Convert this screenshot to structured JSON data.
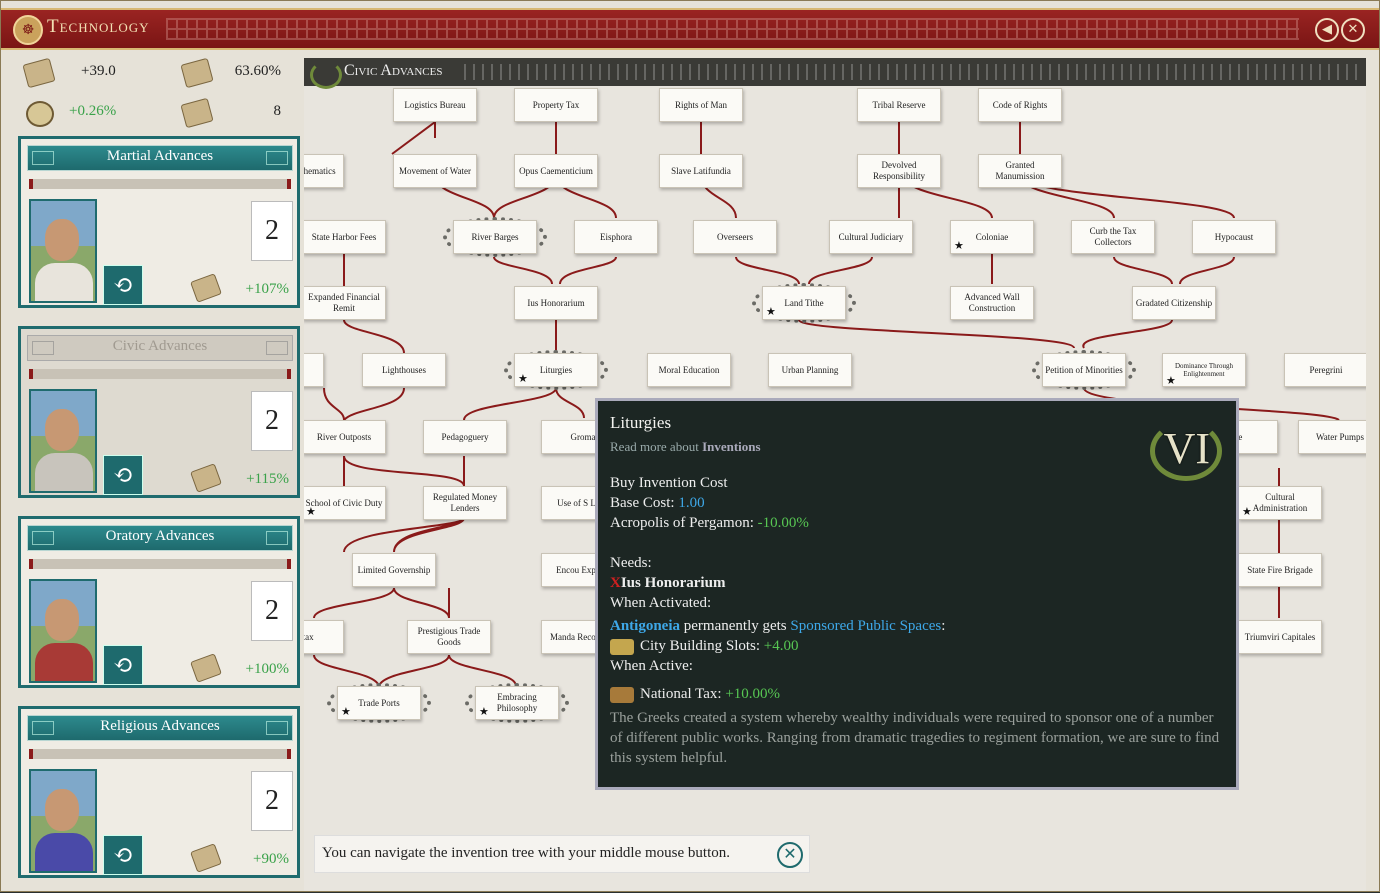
{
  "window": {
    "title": "Technology",
    "back_icon": "back-arrow-icon",
    "close_icon": "close-icon"
  },
  "stats": {
    "research_per_month": "+39.0",
    "research_efficiency": "63.60%",
    "progress_rate": "+0.26%",
    "innovation_count": "8"
  },
  "advances": [
    {
      "label": "Martial Advances",
      "level": "2",
      "bonus": "+107%",
      "icon": "helmet-icon",
      "active": true
    },
    {
      "label": "Civic Advances",
      "level": "2",
      "bonus": "+115%",
      "icon": "laurel-icon",
      "active": false
    },
    {
      "label": "Oratory Advances",
      "level": "2",
      "bonus": "+100%",
      "icon": "scroll-quill-icon",
      "active": true
    },
    {
      "label": "Religious Advances",
      "level": "2",
      "bonus": "+90%",
      "icon": "sun-icon",
      "active": true
    }
  ],
  "tree": {
    "header": "Civic Advances",
    "nodes": [
      {
        "label": "Logistics Bureau"
      },
      {
        "label": "Property Tax"
      },
      {
        "label": "Rights of Man"
      },
      {
        "label": "Tribal Reserve"
      },
      {
        "label": "Code of Rights"
      },
      {
        "label": "hagorean hematics"
      },
      {
        "label": "Movement of Water"
      },
      {
        "label": "Opus Caementicium"
      },
      {
        "label": "Slave Latifundia"
      },
      {
        "label": "Devolved Responsibility"
      },
      {
        "label": "Granted Manumission"
      },
      {
        "label": "State Harbor Fees"
      },
      {
        "label": "River Barges"
      },
      {
        "label": "Eisphora"
      },
      {
        "label": "Overseers"
      },
      {
        "label": "Cultural Judiciary"
      },
      {
        "label": "Coloniae"
      },
      {
        "label": "Curb the Tax Collectors"
      },
      {
        "label": "Hypocaust"
      },
      {
        "label": "Expanded Financial Remit"
      },
      {
        "label": "Ius Honorarium"
      },
      {
        "label": "Land Tithe"
      },
      {
        "label": "Advanced Wall Construction"
      },
      {
        "label": "Gradated Citizenship"
      },
      {
        "label": "Lighthouses"
      },
      {
        "label": "Liturgies"
      },
      {
        "label": "Moral Education"
      },
      {
        "label": "Urban Planning"
      },
      {
        "label": "Petition of Minorities"
      },
      {
        "label": "Dominance Through Enlightenment"
      },
      {
        "label": "Peregrini"
      },
      {
        "label": "River Outposts"
      },
      {
        "label": "Pedagoguery"
      },
      {
        "label": "Groma"
      },
      {
        "label": "al e"
      },
      {
        "label": "Water Pumps"
      },
      {
        "label": "School of Civic Duty"
      },
      {
        "label": "Regulated Money Lenders"
      },
      {
        "label": "Use of S Land"
      },
      {
        "label": "Cultural Administration"
      },
      {
        "label": "Limited Governship"
      },
      {
        "label": "Encou Explora"
      },
      {
        "label": "State Fire Brigade"
      },
      {
        "label": "ort tax"
      },
      {
        "label": "Prestigious Trade Goods"
      },
      {
        "label": "Manda Record Ke"
      },
      {
        "label": "Triumviri Capitales"
      },
      {
        "label": "Trade Ports"
      },
      {
        "label": "Embracing Philosophy"
      }
    ]
  },
  "tooltip": {
    "title": "Liturgies",
    "read_more_prefix": "Read more about",
    "read_more_link": "Inventions",
    "tier": "VI",
    "buy_cost_label": "Buy Invention Cost",
    "base_cost_label": "Base Cost:",
    "base_cost_value": "1.00",
    "modifier_label": "Acropolis of Pergamon:",
    "modifier_value": "-10.00%",
    "needs_label": "Needs:",
    "needs_x": "X",
    "needs_item": "Ius Honorarium",
    "when_activated_label": "When Activated:",
    "city": "Antigoneia",
    "permanently_gets": "permanently gets",
    "building": "Sponsored Public Spaces",
    "colon": ":",
    "slots_label": "City Building Slots:",
    "slots_value": "+4.00",
    "when_active_label": "When Active:",
    "tax_label": "National Tax:",
    "tax_value": "+10.00%",
    "description": "The Greeks created a system whereby wealthy individuals were required to sponsor one of a number of different public works. Ranging from dramatic tragedies to regiment formation, we are sure to find this system helpful."
  },
  "hint": {
    "text": "You can navigate the invention tree with your middle mouse button."
  },
  "colors": {
    "accent_teal": "#1e6a6d",
    "title_red": "#8a1a1a",
    "bonus_green": "#3aa24a",
    "link_blue": "#3ea8e8",
    "gold": "#f0d27a"
  }
}
